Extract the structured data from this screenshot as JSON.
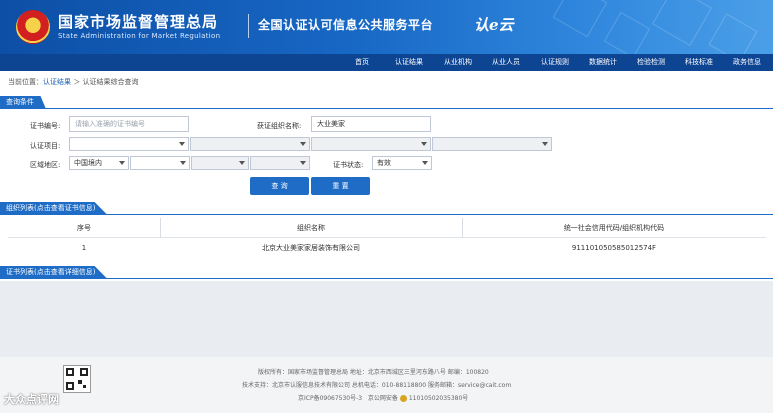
{
  "header": {
    "brand_cn": "国家市场监督管理总局",
    "brand_en": "State Administration  for  Market Regulation",
    "platform": "全国认证认可信息公共服务平台",
    "logo_text": "认e云"
  },
  "nav": [
    "首页",
    "认证结果",
    "从业机构",
    "从业人员",
    "认证规则",
    "数据统计",
    "检验检测",
    "科技标准",
    "政务信息"
  ],
  "breadcrumb": {
    "prefix": "当前位置：",
    "link": "认证结果",
    "sep": "＞",
    "current": "认证结果综合查询"
  },
  "query": {
    "title": "查询条件",
    "cert_no_label": "证书编号:",
    "cert_no_placeholder": "请输入准确的证书编号",
    "org_name_label": "获证组织名称:",
    "org_name_value": "大业美家",
    "project_label": "认证项目:",
    "region_label": "区域地区:",
    "region_value": "中国境内",
    "status_label": "证书状态:",
    "status_value": "有效",
    "search_btn": "查 询",
    "reset_btn": "重 置"
  },
  "orgs": {
    "title": "组织列表(点击查看证书信息)",
    "columns": [
      "序号",
      "组织名称",
      "统一社会信用代码/组织机构代码"
    ],
    "rows": [
      {
        "index": "1",
        "name": "北京大业美家家居装饰有限公司",
        "code": "911101050585012574F"
      }
    ]
  },
  "certs": {
    "title": "证书列表(点击查看详细信息)"
  },
  "footer": {
    "line1": "版权所有：国家市场监督管理总局    地址：北京市西城区三里河东路八号    邮编：100820",
    "line2": "技术支持：北京市认服信息技术有限公司    总机电话：010-88118800    服务邮箱：service@cait.com",
    "icp": "京ICP备09067530号-3",
    "beian": "京公网安备",
    "beian_no": "11010502035380号"
  },
  "watermark": "大众点评网"
}
